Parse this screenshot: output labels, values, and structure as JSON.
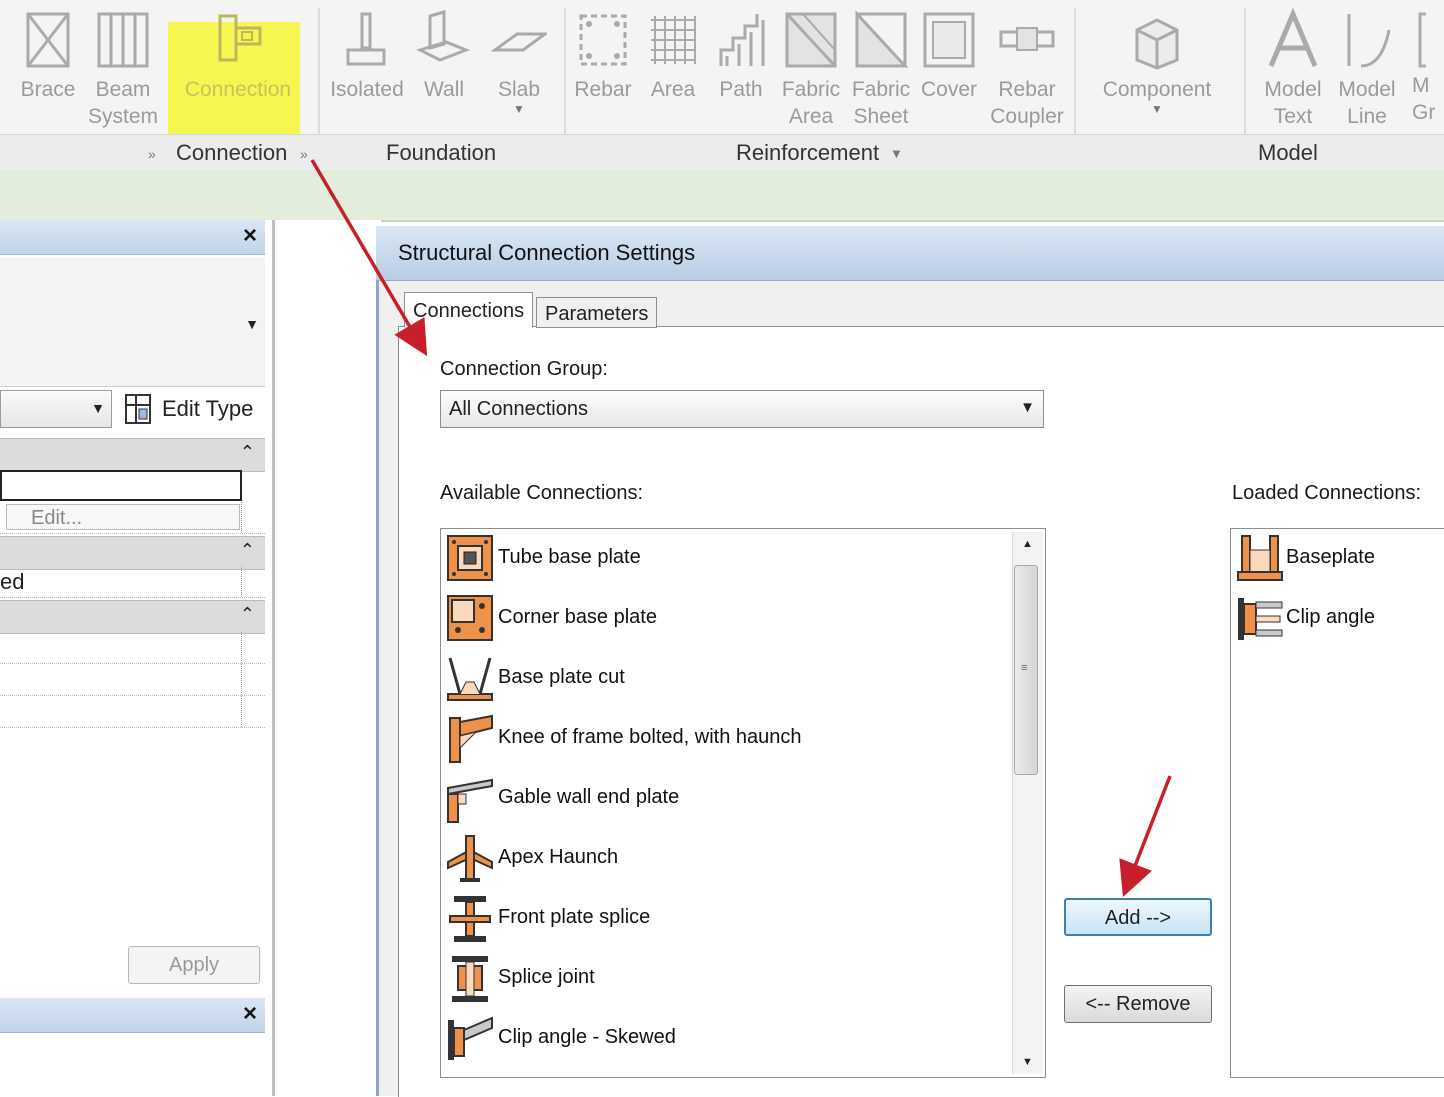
{
  "ribbon": {
    "tools": [
      {
        "label": "Brace"
      },
      {
        "label": "Beam\nSystem"
      },
      {
        "label": "Connection"
      },
      {
        "label": "Isolated"
      },
      {
        "label": "Wall"
      },
      {
        "label": "Slab"
      },
      {
        "label": "Rebar"
      },
      {
        "label": "Area"
      },
      {
        "label": "Path"
      },
      {
        "label": "Fabric\nArea"
      },
      {
        "label": "Fabric\nSheet"
      },
      {
        "label": "Cover"
      },
      {
        "label": "Rebar\nCoupler"
      },
      {
        "label": "Component"
      },
      {
        "label": "Model\nText"
      },
      {
        "label": "Model\nLine"
      },
      {
        "label": "M\nGr"
      }
    ],
    "panels": {
      "connection": "Connection",
      "foundation": "Foundation",
      "reinforcement": "Reinforcement",
      "model": "Model"
    },
    "highlight_color": "#f5f548"
  },
  "properties_palette": {
    "edit_type_label": "Edit Type",
    "edit_button_label": "Edit...",
    "partial_value": "ed",
    "apply_label": "Apply"
  },
  "dialog": {
    "title": "Structural Connection Settings",
    "tabs": [
      {
        "label": "Connections",
        "active": true
      },
      {
        "label": "Parameters",
        "active": false
      }
    ],
    "connection_group_label": "Connection Group:",
    "connection_group_value": "All Connections",
    "available_label": "Available Connections:",
    "loaded_label": "Loaded Connections:",
    "available_connections": [
      {
        "label": "Tube base plate",
        "icon": "tube-base-plate-icon"
      },
      {
        "label": "Corner base plate",
        "icon": "corner-base-plate-icon"
      },
      {
        "label": "Base plate cut",
        "icon": "base-plate-cut-icon"
      },
      {
        "label": "Knee of frame bolted, with haunch",
        "icon": "knee-frame-icon"
      },
      {
        "label": "Gable wall end plate",
        "icon": "gable-wall-icon"
      },
      {
        "label": "Apex Haunch",
        "icon": "apex-haunch-icon"
      },
      {
        "label": "Front plate splice",
        "icon": "front-plate-splice-icon"
      },
      {
        "label": "Splice joint",
        "icon": "splice-joint-icon"
      },
      {
        "label": "Clip angle - Skewed",
        "icon": "clip-angle-skewed-icon"
      }
    ],
    "loaded_connections": [
      {
        "label": "Baseplate",
        "icon": "baseplate-icon"
      },
      {
        "label": "Clip angle",
        "icon": "clip-angle-icon"
      }
    ],
    "add_label": "Add -->",
    "remove_label": "<-- Remove"
  },
  "colors": {
    "annotation_arrow": "#c8202a",
    "icon_orange": "#f0914a",
    "title_bar": "#c4d6ec",
    "green_bar": "#e3eddb"
  }
}
